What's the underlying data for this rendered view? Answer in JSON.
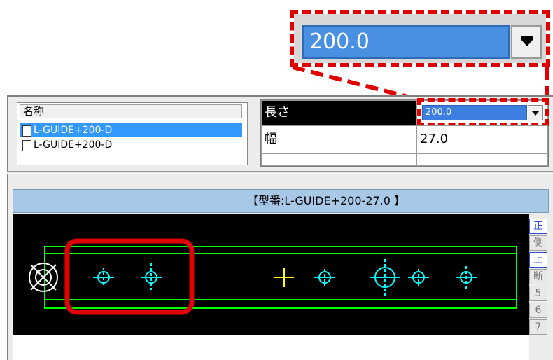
{
  "zoom": {
    "value": "200.0"
  },
  "name_panel": {
    "header": "名称",
    "items": [
      {
        "label": "L-GUIDE+200-D",
        "selected": true
      },
      {
        "label": "L-GUIDE+200-D",
        "selected": false
      }
    ]
  },
  "properties": {
    "rows": [
      {
        "label": "長さ",
        "value": "200.0"
      },
      {
        "label": "幅",
        "value": "27.0"
      },
      {
        "label": "",
        "value": ""
      }
    ]
  },
  "preview": {
    "title": "【型番:L-GUIDE+200-27.0 】",
    "view_tabs": [
      {
        "label": "正",
        "active": true
      },
      {
        "label": "側",
        "active": false
      },
      {
        "label": "上",
        "active": true
      },
      {
        "label": "断",
        "active": false
      },
      {
        "label": "5",
        "active": false
      },
      {
        "label": "6",
        "active": false
      },
      {
        "label": "7",
        "active": false
      }
    ]
  },
  "colors": {
    "outline": "#00ff00",
    "holes": "#00ffff",
    "center_mark": "#ffff00",
    "highlight": "#e00000"
  }
}
